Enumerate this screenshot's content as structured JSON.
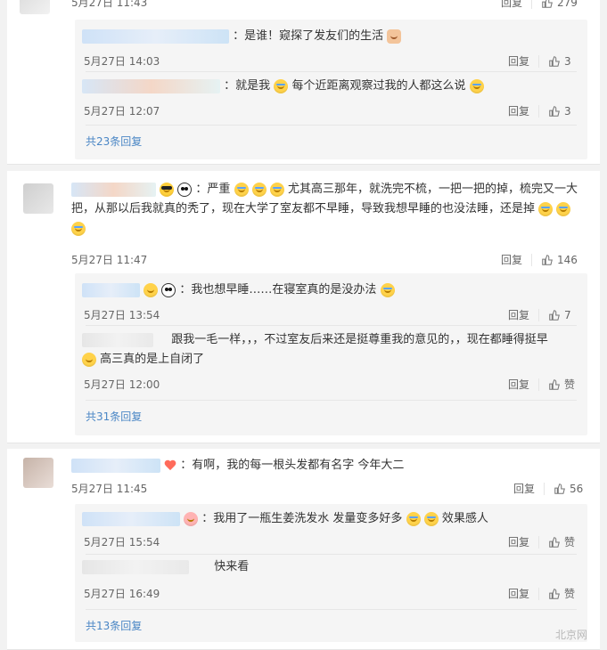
{
  "card1": {
    "top_time": "5月27日 11:43",
    "top_reply": "回复",
    "top_likes": "279",
    "sub": [
      {
        "text": "：是谁！窥探了发友们的生活",
        "time": "5月27日 14:03",
        "reply": "回复",
        "likes": "3"
      },
      {
        "text": "：就是我",
        "text2": "每个近距离观察过我的人都这么说",
        "time": "5月27日 12:07",
        "reply": "回复",
        "likes": "3"
      }
    ],
    "more": "共23条回复"
  },
  "card2": {
    "text_lines": [
      "：严重",
      "尤其高三那年，就洗完不梳，一把一把的掉，梳完又一大",
      "把，从那以后我就真的秃了，现在大学了室友都不早睡，导致我想早睡的也没法睡，还是掉"
    ],
    "time": "5月27日 11:47",
    "reply": "回复",
    "likes": "146",
    "sub": [
      {
        "text": "：我也想早睡……在寝室真的是没办法",
        "time": "5月27日 13:54",
        "reply": "回复",
        "likes": "7"
      },
      {
        "text_line1": "跟我一毛一样，，，不过室友后来还是挺尊重我的意见的，，现在都睡得挺早",
        "text_line2": "高三真的是上自闭了",
        "time": "5月27日 12:00",
        "reply": "回复",
        "likes": "赞"
      }
    ],
    "more": "共31条回复"
  },
  "card3": {
    "text": "：有啊，我的每一根头发都有名字 今年大二",
    "time": "5月27日 11:45",
    "reply": "回复",
    "likes": "56",
    "sub": [
      {
        "text1": "：我用了一瓶生姜洗发水 发量变多好多",
        "text2": "效果感人",
        "time": "5月27日 15:54",
        "reply": "回复",
        "likes": "赞"
      },
      {
        "text": "快来看",
        "time": "5月27日 16:49",
        "reply": "回复",
        "likes": "赞"
      }
    ],
    "more": "共13条回复"
  },
  "watermark": "北京网"
}
